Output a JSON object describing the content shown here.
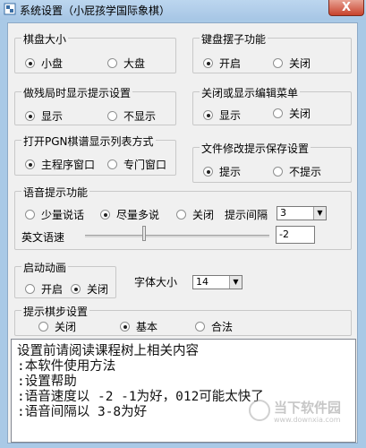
{
  "window": {
    "title": "系统设置（小屁孩学国际象棋）",
    "close_label": "X"
  },
  "board_size": {
    "title": "棋盘大小",
    "options": [
      "小盘",
      "大盘"
    ],
    "selected": 0
  },
  "keyboard": {
    "title": "键盘摆子功能",
    "options": [
      "开启",
      "关闭"
    ],
    "selected": 0
  },
  "hint_setting": {
    "title": "做残局时显示提示设置",
    "options": [
      "显示",
      "不显示"
    ],
    "selected": 0
  },
  "edit_menu": {
    "title": "关闭或显示编辑菜单",
    "options": [
      "显示",
      "关闭"
    ],
    "selected": 0
  },
  "pgn_mode": {
    "title": "打开PGN棋谱显示列表方式",
    "options": [
      "主程序窗口",
      "专门窗口"
    ],
    "selected": 0
  },
  "save_prompt": {
    "title": "文件修改提示保存设置",
    "options": [
      "提示",
      "不提示"
    ],
    "selected": 0
  },
  "voice": {
    "title": "语音提示功能",
    "options": [
      "少量说话",
      "尽量多说",
      "关闭"
    ],
    "selected": 1,
    "interval_label": "提示间隔",
    "interval_value": "3",
    "speed_label": "英文语速",
    "speed_value": "-2"
  },
  "startup_anim": {
    "title": "启动动画",
    "options": [
      "开启",
      "关闭"
    ],
    "selected": 1
  },
  "font": {
    "label": "字体大小",
    "value": "14"
  },
  "move_hint": {
    "title": "提示棋步设置",
    "options": [
      "关闭",
      "基本",
      "合法"
    ],
    "selected": 1
  },
  "help_text": {
    "lines": [
      "设置前请阅读课程树上相关内容",
      ":本软件使用方法",
      ":设置帮助",
      ":语音速度以 -2 -1为好，012可能太快了",
      ":语音间隔以 3-8为好"
    ]
  },
  "watermark": {
    "text": "当下软件园",
    "url": "www.downxia.com"
  }
}
